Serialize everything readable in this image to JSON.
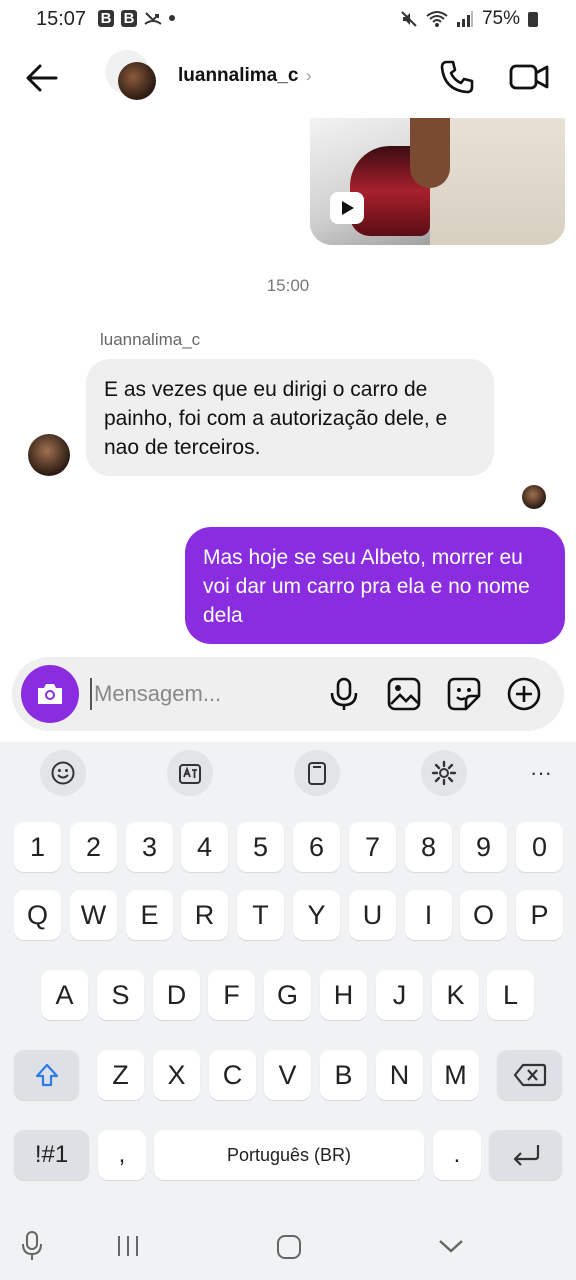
{
  "status_bar": {
    "time": "15:07",
    "battery": "75%",
    "left_icons": [
      "B",
      "B"
    ]
  },
  "header": {
    "username": "luannalima_c",
    "chevron": "›"
  },
  "chat": {
    "timestamp": "15:00",
    "incoming_sender": "luannalima_c",
    "incoming_message": "E as vezes que eu dirigi o carro de painho, foi com a autorização dele, e nao de terceiros.",
    "outgoing_message": "Mas hoje se seu Albeto, morrer eu voi dar um carro pra ela e no nome dela"
  },
  "composer": {
    "placeholder": "Mensagem..."
  },
  "keyboard": {
    "number_row": [
      "1",
      "2",
      "3",
      "4",
      "5",
      "6",
      "7",
      "8",
      "9",
      "0"
    ],
    "row1": [
      "Q",
      "W",
      "E",
      "R",
      "T",
      "Y",
      "U",
      "I",
      "O",
      "P"
    ],
    "row2": [
      "A",
      "S",
      "D",
      "F",
      "G",
      "H",
      "J",
      "K",
      "L"
    ],
    "row3": [
      "Z",
      "X",
      "C",
      "V",
      "B",
      "N",
      "M"
    ],
    "symbols_key": "!#1",
    "comma_key": ",",
    "space_label": "Português (BR)",
    "period_key": ".",
    "toolbar_more": "···"
  },
  "colors": {
    "accent": "#8a2de0",
    "bubble_in": "#efefef",
    "keyboard_bg": "#f1f2f4"
  }
}
